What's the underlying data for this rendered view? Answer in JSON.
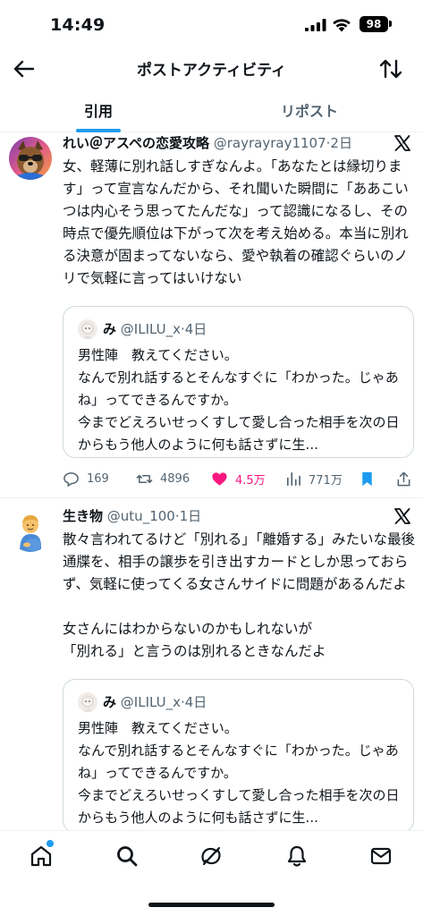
{
  "status": {
    "time": "14:49",
    "battery": "98"
  },
  "header": {
    "title": "ポストアクティビティ",
    "back_icon": "arrow-left-icon",
    "sort_icon": "swap-vertical-icon"
  },
  "tabs": [
    {
      "label": "引用",
      "active": true
    },
    {
      "label": "リポスト",
      "active": false
    }
  ],
  "posts": [
    {
      "name": "れい＠アスペの恋愛攻略",
      "handle": "@rayrayray1107",
      "time": "2日",
      "text": "女、軽薄に別れ話しすぎなんよ。「あなたとは縁切ります」って宣言なんだから、それ聞いた瞬間に「ああこいつは内心そう思ってたんだな」って認識になるし、その時点で優先順位は下がって次を考え始める。本当に別れる決意が固まってないなら、愛や執着の確認ぐらいのノリで気軽に言ってはいけない",
      "quote": {
        "name": "み",
        "handle": "@ILILU_x",
        "time": "4日",
        "text": "男性陣　教えてください。\nなんで別れ話するとそんなすぐに「わかった。じゃあね」ってできるんですか。\n今までどえろいせっくすして愛し合った相手を次の日からもう他人のように何も話さずに生..."
      },
      "stats": {
        "replies": "169",
        "reposts": "4896",
        "likes": "4.5万",
        "views": "771万"
      }
    },
    {
      "name": "生き物",
      "handle": "@utu_100",
      "time": "1日",
      "text": "散々言われてるけど「別れる」「離婚する」みたいな最後通牒を、相手の譲歩を引き出すカードとしか思っておらず、気軽に使ってくる女さんサイドに問題があるんだよ\n\n女さんにはわからないのかもしれないが\n「別れる」と言うのは別れるときなんだよ",
      "quote": {
        "name": "み",
        "handle": "@ILILU_x",
        "time": "4日",
        "text": "男性陣　教えてください。\nなんで別れ話するとそんなすぐに「わかった。じゃあね」ってできるんですか。\n今までどえろいせっくすして愛し合った相手を次の日からもう他人のように何も話さずに生..."
      }
    }
  ],
  "bottom_nav": [
    "home-icon",
    "search-icon",
    "grok-icon",
    "bell-icon",
    "mail-icon"
  ],
  "colors": {
    "accent": "#1d9bf0",
    "like": "#f91880",
    "muted": "#536471"
  }
}
